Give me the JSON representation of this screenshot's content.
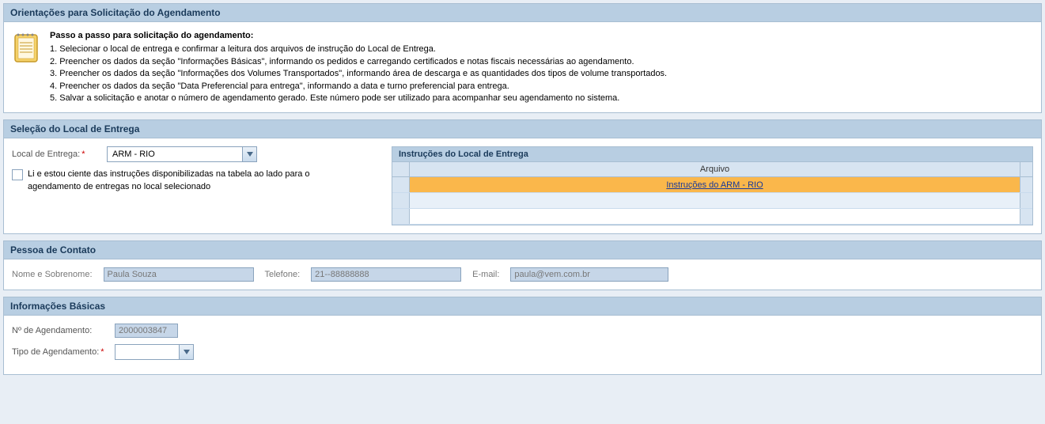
{
  "orientacoes": {
    "header": "Orientações para Solicitação do Agendamento",
    "title": "Passo a passo para solicitação do agendamento:",
    "steps": [
      "1. Selecionar o local de entrega e confirmar a leitura dos arquivos de instrução do Local de Entrega.",
      "2. Preencher os dados da seção \"Informações Básicas\", informando os pedidos e carregando certificados e notas fiscais necessárias ao agendamento.",
      "3. Preencher os dados da seção \"Informações dos Volumes Transportados\", informando área de descarga e as quantidades dos tipos de volume transportados.",
      "4. Preencher os dados da seção \"Data Preferencial para entrega\", informando a data e turno preferencial para entrega.",
      "5. Salvar a solicitação e anotar o número de agendamento gerado. Este número pode ser utilizado para acompanhar seu agendamento no sistema."
    ]
  },
  "selecao": {
    "header": "Seleção do Local de Entrega",
    "local_label": "Local de Entrega:",
    "local_value": "ARM - RIO",
    "checkbox_label": "Li e estou ciente das instruções disponibilizadas na tabela ao lado para o agendamento de entregas no local selecionado",
    "instrucoes_header": "Instruções do Local de Entrega",
    "grid_column": "Arquivo",
    "grid_link": "Instruções do ARM - RIO"
  },
  "contato": {
    "header": "Pessoa de Contato",
    "nome_label": "Nome e Sobrenome:",
    "nome_value": "Paula Souza",
    "tel_label": "Telefone:",
    "tel_value": "21--88888888",
    "email_label": "E-mail:",
    "email_value": "paula@vem.com.br"
  },
  "basicas": {
    "header": "Informações Básicas",
    "num_label": "Nº de Agendamento:",
    "num_value": "2000003847",
    "tipo_label": "Tipo de Agendamento:",
    "tipo_value": ""
  }
}
